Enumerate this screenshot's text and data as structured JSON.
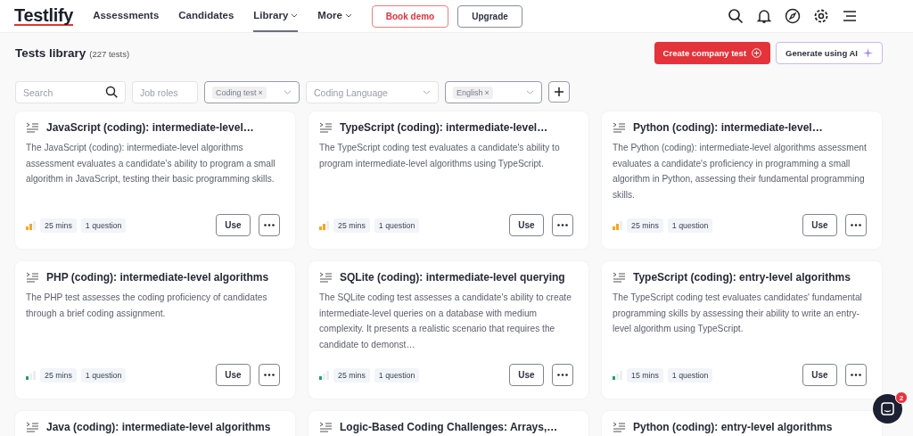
{
  "nav": {
    "logo": "Testlify",
    "links": [
      {
        "label": "Assessments",
        "selected": false,
        "dropdown": false
      },
      {
        "label": "Candidates",
        "selected": false,
        "dropdown": false
      },
      {
        "label": "Library",
        "selected": true,
        "dropdown": true
      },
      {
        "label": "More",
        "selected": false,
        "dropdown": true
      }
    ],
    "book_demo": "Book demo",
    "upgrade": "Upgrade"
  },
  "header": {
    "title": "Tests library",
    "count": "(227 tests)",
    "create_button": "Create company test",
    "ai_button": "Generate using AI"
  },
  "filters": {
    "search": {
      "placeholder": "Search"
    },
    "job_roles": {
      "placeholder": "Job roles"
    },
    "test_type": {
      "chip": "Coding test",
      "remove": "×"
    },
    "coding_language": {
      "placeholder": "Coding Language"
    },
    "language": {
      "chip": "English",
      "remove": "×"
    }
  },
  "cards": [
    {
      "title": "JavaScript (coding): intermediate-level…",
      "description": "The JavaScript (coding): intermediate-level algorithms assessment evaluates a candidate’s ability to program a small algorithm in JavaScript, testing their basic programming skills.",
      "level": 0.67,
      "color": "#f5a623",
      "duration": "25 mins",
      "questions": "1 question",
      "use": "Use"
    },
    {
      "title": "TypeScript (coding): intermediate-level…",
      "description": "The TypeScript coding test evaluates a candidate's ability to program intermediate-level algorithms using TypeScript.",
      "level": 0.67,
      "color": "#f5a623",
      "duration": "25 mins",
      "questions": "1 question",
      "use": "Use"
    },
    {
      "title": "Python (coding): intermediate-level…",
      "description": "The Python (coding): intermediate-level algorithms assessment evaluates a candidate's proficiency in programming a small algorithm in Python, assessing their fundamental programming skills.",
      "level": 0.67,
      "color": "#f5a623",
      "duration": "25 mins",
      "questions": "1 question",
      "use": "Use"
    },
    {
      "title": "PHP (coding): intermediate-level algorithms",
      "description": "The PHP test assesses the coding proficiency of candidates through a brief coding assignment.",
      "level": 0.33,
      "color": "#22a06b",
      "duration": "25 mins",
      "questions": "1 question",
      "use": "Use"
    },
    {
      "title": "SQLite (coding): intermediate-level querying",
      "description": "The SQLite coding test assesses a candidate's ability to create intermediate-level queries on a database with medium complexity. It presents a realistic scenario that requires the candidate to demonst…",
      "level": 0.33,
      "color": "#22a06b",
      "duration": "25 mins",
      "questions": "1 question",
      "use": "Use"
    },
    {
      "title": "TypeScript (coding): entry-level algorithms",
      "description": "The TypeScript coding test evaluates candidates' fundamental programming skills by assessing their ability to write an entry-level algorithm using TypeScript.",
      "level": 0.33,
      "color": "#22a06b",
      "duration": "15 mins",
      "questions": "1 question",
      "use": "Use"
    },
    {
      "title": "Java (coding): intermediate-level algorithms"
    },
    {
      "title": "Logic-Based Coding Challenges: Arrays,…"
    },
    {
      "title": "Python (coding): entry-level algorithms"
    }
  ],
  "chat": {
    "badge": "2"
  }
}
